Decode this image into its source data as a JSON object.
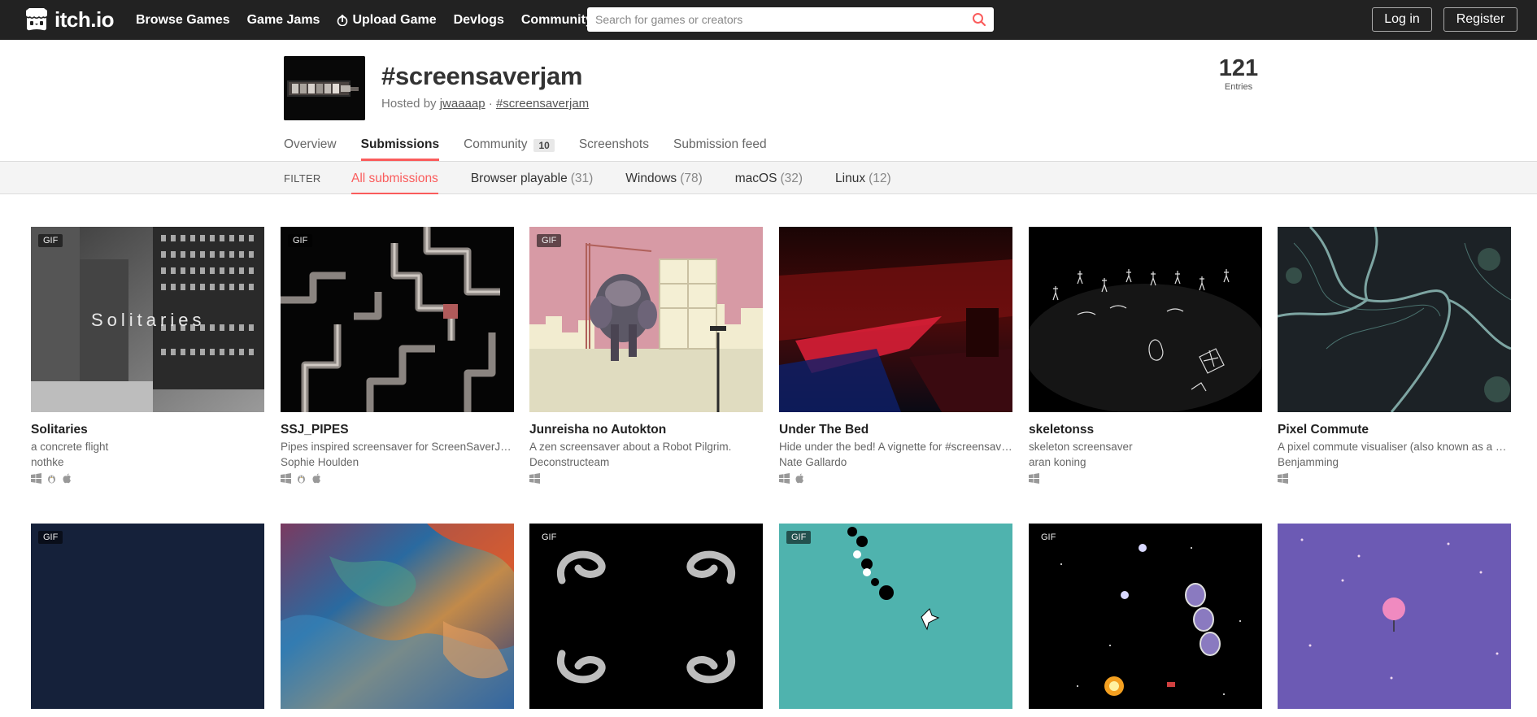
{
  "header": {
    "logo_text": "itch.io",
    "nav": [
      {
        "label": "Browse Games"
      },
      {
        "label": "Game Jams"
      },
      {
        "label": "Upload Game"
      },
      {
        "label": "Devlogs"
      },
      {
        "label": "Community"
      }
    ],
    "search_placeholder": "Search for games or creators",
    "login_label": "Log in",
    "register_label": "Register"
  },
  "jam": {
    "title": "#screensaverjam",
    "hosted_by_prefix": "Hosted by",
    "host": "jwaaaap",
    "separator": "·",
    "hashtag": "#screensaverjam",
    "entries_count": "121",
    "entries_label": "Entries",
    "tabs": [
      {
        "label": "Overview"
      },
      {
        "label": "Submissions",
        "active": true
      },
      {
        "label": "Community",
        "badge": "10"
      },
      {
        "label": "Screenshots"
      },
      {
        "label": "Submission feed"
      }
    ]
  },
  "filter": {
    "label": "FILTER",
    "items": [
      {
        "label": "All submissions",
        "count": "",
        "active": true
      },
      {
        "label": "Browser playable",
        "count": "(31)"
      },
      {
        "label": "Windows",
        "count": "(78)"
      },
      {
        "label": "macOS",
        "count": "(32)"
      },
      {
        "label": "Linux",
        "count": "(12)"
      }
    ]
  },
  "gif_label": "GIF",
  "games": [
    {
      "title": "Solitaries",
      "desc": "a concrete flight",
      "author": "nothke",
      "gif": true,
      "platforms": [
        "windows-icon",
        "linux-icon",
        "apple-icon"
      ],
      "overlay_text": "Solitaries"
    },
    {
      "title": "SSJ_PIPES",
      "desc": "Pipes inspired screensaver for ScreenSaverJam",
      "author": "Sophie Houlden",
      "gif": true,
      "platforms": [
        "windows-icon",
        "linux-icon",
        "apple-icon"
      ]
    },
    {
      "title": "Junreisha no Autokton",
      "desc": "A zen screensaver about a Robot Pilgrim.",
      "author": "Deconstructeam",
      "gif": true,
      "platforms": [
        "windows-icon"
      ]
    },
    {
      "title": "Under The Bed",
      "desc": "Hide under the bed! A vignette for #screensaverjam",
      "author": "Nate Gallardo",
      "gif": false,
      "platforms": [
        "windows-icon",
        "apple-icon"
      ]
    },
    {
      "title": "skeletonss",
      "desc": "skeleton screensaver",
      "author": "aran koning",
      "gif": false,
      "platforms": [
        "windows-icon"
      ]
    },
    {
      "title": "Pixel Commute",
      "desc": "A pixel commute visualiser (also known as a screensaver)",
      "author": "Benjamming",
      "gif": false,
      "platforms": [
        "windows-icon"
      ]
    },
    {
      "gif": true
    },
    {
      "gif": false
    },
    {
      "gif": true
    },
    {
      "gif": true
    },
    {
      "gif": true
    },
    {
      "gif": false
    }
  ]
}
